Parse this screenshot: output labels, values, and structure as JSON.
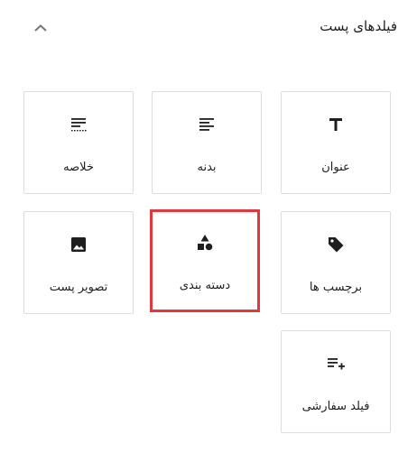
{
  "panel": {
    "title": "فیلدهای پست",
    "toggle_icon": "chevron-up-icon"
  },
  "accent_color": "#e0383e",
  "fields": [
    {
      "key": "summary",
      "label": "خلاصه",
      "icon": "excerpt-icon"
    },
    {
      "key": "body",
      "label": "بدنه",
      "icon": "align-left-icon"
    },
    {
      "key": "title",
      "label": "عنوان",
      "icon": "text-t-icon"
    },
    {
      "key": "image",
      "label": "تصویر پست",
      "icon": "image-icon"
    },
    {
      "key": "category",
      "label": "دسته بندی",
      "icon": "shapes-icon",
      "selected": true
    },
    {
      "key": "tags",
      "label": "برچسب ها",
      "icon": "tag-icon"
    },
    {
      "key": "custom",
      "label": "فیلد سفارشی",
      "icon": "list-add-icon"
    }
  ]
}
